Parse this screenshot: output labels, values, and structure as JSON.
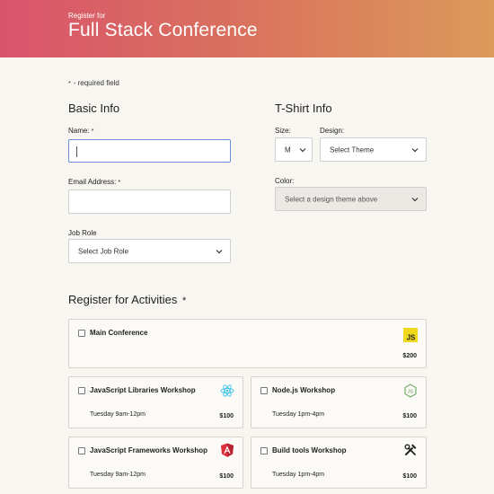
{
  "header": {
    "subtitle": "Register for",
    "title": "Full Stack Conference"
  },
  "required_note": {
    "marker": "*",
    "text": "- required field"
  },
  "basic_info": {
    "heading": "Basic Info",
    "name_label": "Name:",
    "name_value": "",
    "email_label": "Email Address:",
    "email_value": "",
    "job_role_label": "Job Role",
    "job_role_value": "Select Job Role",
    "required_marker": "*"
  },
  "tshirt_info": {
    "heading": "T-Shirt Info",
    "size_label": "Size:",
    "size_value": "M",
    "design_label": "Design:",
    "design_value": "Select Theme",
    "color_label": "Color:",
    "color_value": "Select a design theme above"
  },
  "activities": {
    "heading": "Register for Activities",
    "required_marker": "*",
    "items": [
      {
        "name": "Main Conference",
        "time": "",
        "price": "$200",
        "icon": "js-icon"
      },
      {
        "name": "JavaScript Libraries Workshop",
        "time": "Tuesday 9am-12pm",
        "price": "$100",
        "icon": "react-icon"
      },
      {
        "name": "Node.js Workshop",
        "time": "Tuesday 1pm-4pm",
        "price": "$100",
        "icon": "nodejs-icon"
      },
      {
        "name": "JavaScript Frameworks Workshop",
        "time": "Tuesday 9am-12pm",
        "price": "$100",
        "icon": "angular-icon"
      },
      {
        "name": "Build tools Workshop",
        "time": "Tuesday 1pm-4pm",
        "price": "$100",
        "icon": "tools-icon"
      }
    ]
  },
  "colors": {
    "header_start": "#d9546c",
    "header_end": "#dc9a5a",
    "background": "#f8f6f1",
    "focus": "#6b8fd6"
  }
}
